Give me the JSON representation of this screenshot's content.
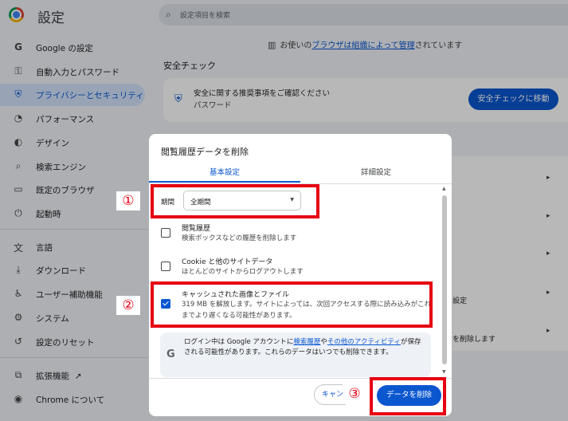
{
  "app": {
    "title": "設定",
    "search_placeholder": "設定項目を検索"
  },
  "sidebar": {
    "items": [
      {
        "label": "Google の設定",
        "icon": "G"
      },
      {
        "label": "自動入力とパスワード",
        "icon": "⚿"
      },
      {
        "label": "プライバシーとセキュリティ",
        "icon": "⛨",
        "active": true
      },
      {
        "label": "パフォーマンス",
        "icon": "◔"
      },
      {
        "label": "デザイン",
        "icon": "◐"
      },
      {
        "label": "検索エンジン",
        "icon": "⌕"
      },
      {
        "label": "既定のブラウザ",
        "icon": "▭"
      },
      {
        "label": "起動時",
        "icon": "⏻"
      },
      {
        "label": "言語",
        "icon": "文"
      },
      {
        "label": "ダウンロード",
        "icon": "⤓"
      },
      {
        "label": "ユーザー補助機能",
        "icon": "♿"
      },
      {
        "label": "システム",
        "icon": "⚙"
      },
      {
        "label": "設定のリセット",
        "icon": "↺"
      },
      {
        "label": "拡張機能",
        "icon": "⧉",
        "external": "↗"
      },
      {
        "label": "Chrome について",
        "icon": "◉"
      }
    ]
  },
  "managed_notice": {
    "prefix": "お使いの",
    "link": "ブラウザは組織によって管理",
    "suffix": "されています"
  },
  "safety_check": {
    "section_title": "安全チェック",
    "line1": "安全に関する推奨事項をご確認ください",
    "line2": "パスワード",
    "button": "安全チェックに移動"
  },
  "background_fragments": {
    "row4": "設定",
    "row5": "を削除します"
  },
  "dialog": {
    "title": "閲覧履歴データを削除",
    "tabs": [
      {
        "label": "基本設定",
        "active": true
      },
      {
        "label": "詳細設定",
        "active": false
      }
    ],
    "period": {
      "label": "期間",
      "value": "全期間"
    },
    "options": [
      {
        "title": "閲覧履歴",
        "desc": "検索ボックスなどの履歴を削除します",
        "checked": false
      },
      {
        "title": "Cookie と他のサイトデータ",
        "desc": "ほとんどのサイトからログアウトします",
        "checked": false
      },
      {
        "title": "キャッシュされた画像とファイル",
        "desc": "319 MB を解放します。サイトによっては、次回アクセスする際に読み込みがこれまでより遅くなる可能性があります。",
        "checked": true
      }
    ],
    "info": {
      "g": "G",
      "part1": "ログイン中は Google アカウントに",
      "link1": "検索履歴",
      "part2": "や",
      "link2": "その他のアクティビティ",
      "part3": "が保存される可能性があります。これらのデータはいつでも削除できます。"
    },
    "cancel_label": "キャンセル",
    "delete_label": "データを削除"
  },
  "annotations": {
    "n1": "①",
    "n2": "②",
    "n3": "③"
  },
  "colors": {
    "accent": "#0b57d0",
    "callout": "#e60012"
  }
}
